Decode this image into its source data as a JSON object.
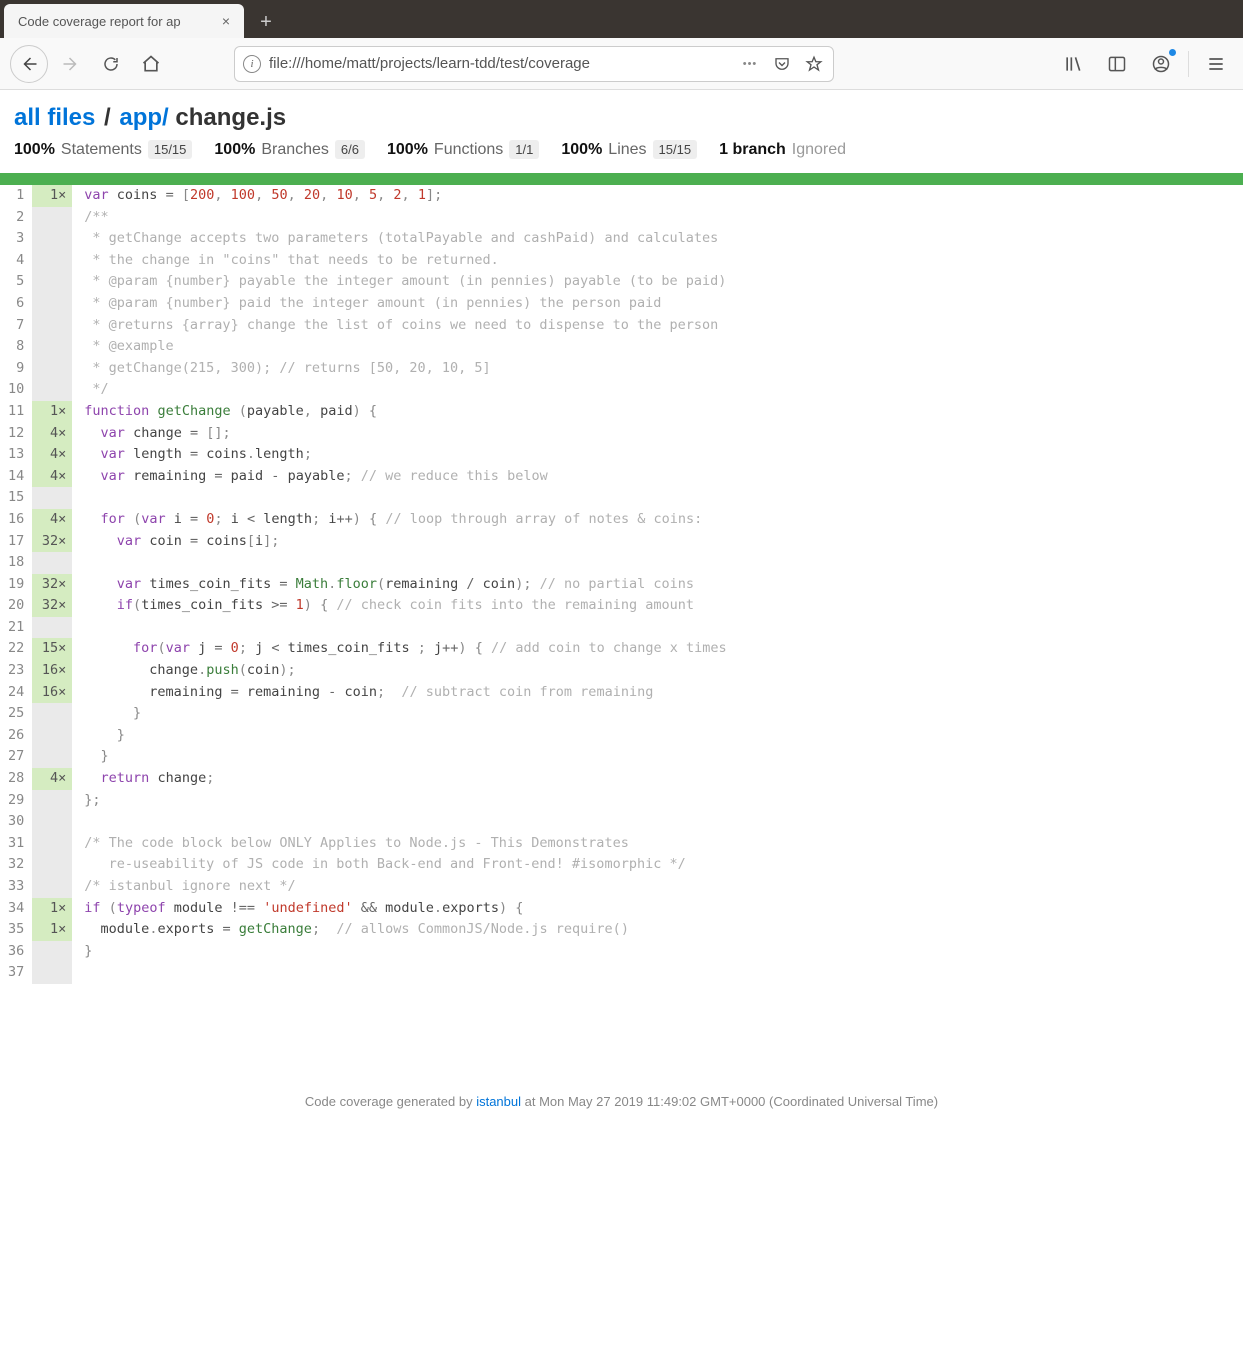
{
  "browser": {
    "tab_title": "Code coverage report for ap",
    "url": "file:///home/matt/projects/learn-tdd/test/coverage",
    "new_tab_glyph": "+",
    "close_glyph": "×",
    "info_glyph": "i",
    "dots_glyph": "•••"
  },
  "breadcrumb": {
    "root": "all files",
    "folder": "app/",
    "file": "change.js",
    "sep": "/"
  },
  "stats": [
    {
      "pct": "100%",
      "label": "Statements",
      "frac": "15/15"
    },
    {
      "pct": "100%",
      "label": "Branches",
      "frac": "6/6"
    },
    {
      "pct": "100%",
      "label": "Functions",
      "frac": "1/1"
    },
    {
      "pct": "100%",
      "label": "Lines",
      "frac": "15/15"
    }
  ],
  "ignored": {
    "bold": "1 branch",
    "label": "Ignored"
  },
  "code": {
    "lines": [
      {
        "n": 1,
        "hits": "1×",
        "tokens": [
          [
            "kw",
            "var"
          ],
          [
            "",
            " "
          ],
          [
            "id",
            "coins"
          ],
          [
            "",
            " "
          ],
          [
            "op",
            "="
          ],
          [
            "",
            " "
          ],
          [
            "pn",
            "["
          ],
          [
            "num",
            "200"
          ],
          [
            "pn",
            ","
          ],
          [
            "",
            " "
          ],
          [
            "num",
            "100"
          ],
          [
            "pn",
            ","
          ],
          [
            "",
            " "
          ],
          [
            "num",
            "50"
          ],
          [
            "pn",
            ","
          ],
          [
            "",
            " "
          ],
          [
            "num",
            "20"
          ],
          [
            "pn",
            ","
          ],
          [
            "",
            " "
          ],
          [
            "num",
            "10"
          ],
          [
            "pn",
            ","
          ],
          [
            "",
            " "
          ],
          [
            "num",
            "5"
          ],
          [
            "pn",
            ","
          ],
          [
            "",
            " "
          ],
          [
            "num",
            "2"
          ],
          [
            "pn",
            ","
          ],
          [
            "",
            " "
          ],
          [
            "num",
            "1"
          ],
          [
            "pn",
            "];"
          ]
        ]
      },
      {
        "n": 2,
        "hits": "",
        "tokens": [
          [
            "cm",
            "/**"
          ]
        ]
      },
      {
        "n": 3,
        "hits": "",
        "tokens": [
          [
            "cm",
            " * getChange accepts two parameters (totalPayable and cashPaid) and calculates"
          ]
        ]
      },
      {
        "n": 4,
        "hits": "",
        "tokens": [
          [
            "cm",
            " * the change in \"coins\" that needs to be returned."
          ]
        ]
      },
      {
        "n": 5,
        "hits": "",
        "tokens": [
          [
            "cm",
            " * @param {number} payable the integer amount (in pennies) payable (to be paid)"
          ]
        ]
      },
      {
        "n": 6,
        "hits": "",
        "tokens": [
          [
            "cm",
            " * @param {number} paid the integer amount (in pennies) the person paid"
          ]
        ]
      },
      {
        "n": 7,
        "hits": "",
        "tokens": [
          [
            "cm",
            " * @returns {array} change the list of coins we need to dispense to the person"
          ]
        ]
      },
      {
        "n": 8,
        "hits": "",
        "tokens": [
          [
            "cm",
            " * @example"
          ]
        ]
      },
      {
        "n": 9,
        "hits": "",
        "tokens": [
          [
            "cm",
            " * getChange(215, 300); // returns [50, 20, 10, 5]"
          ]
        ]
      },
      {
        "n": 10,
        "hits": "",
        "tokens": [
          [
            "cm",
            " */"
          ]
        ]
      },
      {
        "n": 11,
        "hits": "1×",
        "tokens": [
          [
            "kw",
            "function"
          ],
          [
            "",
            " "
          ],
          [
            "fn",
            "getChange"
          ],
          [
            "",
            " "
          ],
          [
            "pn",
            "("
          ],
          [
            "id",
            "payable"
          ],
          [
            "pn",
            ","
          ],
          [
            "",
            " "
          ],
          [
            "id",
            "paid"
          ],
          [
            "pn",
            ")"
          ],
          [
            "",
            " "
          ],
          [
            "pn",
            "{"
          ]
        ]
      },
      {
        "n": 12,
        "hits": "4×",
        "tokens": [
          [
            "",
            "  "
          ],
          [
            "kw",
            "var"
          ],
          [
            "",
            " "
          ],
          [
            "id",
            "change"
          ],
          [
            "",
            " "
          ],
          [
            "op",
            "="
          ],
          [
            "",
            " "
          ],
          [
            "pn",
            "[];"
          ]
        ]
      },
      {
        "n": 13,
        "hits": "4×",
        "tokens": [
          [
            "",
            "  "
          ],
          [
            "kw",
            "var"
          ],
          [
            "",
            " "
          ],
          [
            "id",
            "length"
          ],
          [
            "",
            " "
          ],
          [
            "op",
            "="
          ],
          [
            "",
            " "
          ],
          [
            "id",
            "coins"
          ],
          [
            "pn",
            "."
          ],
          [
            "id",
            "length"
          ],
          [
            "pn",
            ";"
          ]
        ]
      },
      {
        "n": 14,
        "hits": "4×",
        "tokens": [
          [
            "",
            "  "
          ],
          [
            "kw",
            "var"
          ],
          [
            "",
            " "
          ],
          [
            "id",
            "remaining"
          ],
          [
            "",
            " "
          ],
          [
            "op",
            "="
          ],
          [
            "",
            " "
          ],
          [
            "id",
            "paid"
          ],
          [
            "",
            " "
          ],
          [
            "op",
            "-"
          ],
          [
            "",
            " "
          ],
          [
            "id",
            "payable"
          ],
          [
            "pn",
            ";"
          ],
          [
            "",
            " "
          ],
          [
            "cm",
            "// we reduce this below"
          ]
        ]
      },
      {
        "n": 15,
        "hits": "",
        "tokens": [
          [
            "",
            " "
          ]
        ]
      },
      {
        "n": 16,
        "hits": "4×",
        "tokens": [
          [
            "",
            "  "
          ],
          [
            "kw",
            "for"
          ],
          [
            "",
            " "
          ],
          [
            "pn",
            "("
          ],
          [
            "kw",
            "var"
          ],
          [
            "",
            " "
          ],
          [
            "id",
            "i"
          ],
          [
            "",
            " "
          ],
          [
            "op",
            "="
          ],
          [
            "",
            " "
          ],
          [
            "num",
            "0"
          ],
          [
            "pn",
            ";"
          ],
          [
            "",
            " "
          ],
          [
            "id",
            "i"
          ],
          [
            "",
            " "
          ],
          [
            "op",
            "<"
          ],
          [
            "",
            " "
          ],
          [
            "id",
            "length"
          ],
          [
            "pn",
            ";"
          ],
          [
            "",
            " "
          ],
          [
            "id",
            "i"
          ],
          [
            "op",
            "++"
          ],
          [
            "pn",
            ")"
          ],
          [
            "",
            " "
          ],
          [
            "pn",
            "{"
          ],
          [
            "",
            " "
          ],
          [
            "cm",
            "// loop through array of notes & coins:"
          ]
        ]
      },
      {
        "n": 17,
        "hits": "32×",
        "tokens": [
          [
            "",
            "    "
          ],
          [
            "kw",
            "var"
          ],
          [
            "",
            " "
          ],
          [
            "id",
            "coin"
          ],
          [
            "",
            " "
          ],
          [
            "op",
            "="
          ],
          [
            "",
            " "
          ],
          [
            "id",
            "coins"
          ],
          [
            "pn",
            "["
          ],
          [
            "id",
            "i"
          ],
          [
            "pn",
            "];"
          ]
        ]
      },
      {
        "n": 18,
        "hits": "",
        "tokens": [
          [
            "",
            " "
          ]
        ]
      },
      {
        "n": 19,
        "hits": "32×",
        "tokens": [
          [
            "",
            "    "
          ],
          [
            "kw",
            "var"
          ],
          [
            "",
            " "
          ],
          [
            "id",
            "times_coin_fits"
          ],
          [
            "",
            " "
          ],
          [
            "op",
            "="
          ],
          [
            "",
            " "
          ],
          [
            "fn",
            "Math"
          ],
          [
            "pn",
            "."
          ],
          [
            "fn",
            "floor"
          ],
          [
            "pn",
            "("
          ],
          [
            "id",
            "remaining"
          ],
          [
            "",
            " "
          ],
          [
            "op",
            "/"
          ],
          [
            "",
            " "
          ],
          [
            "id",
            "coin"
          ],
          [
            "pn",
            ");"
          ],
          [
            "",
            " "
          ],
          [
            "cm",
            "// no partial coins"
          ]
        ]
      },
      {
        "n": 20,
        "hits": "32×",
        "tokens": [
          [
            "",
            "    "
          ],
          [
            "kw",
            "if"
          ],
          [
            "pn",
            "("
          ],
          [
            "id",
            "times_coin_fits"
          ],
          [
            "",
            " "
          ],
          [
            "op",
            ">="
          ],
          [
            "",
            " "
          ],
          [
            "num",
            "1"
          ],
          [
            "pn",
            ")"
          ],
          [
            "",
            " "
          ],
          [
            "pn",
            "{"
          ],
          [
            "",
            " "
          ],
          [
            "cm",
            "// check coin fits into the remaining amount"
          ]
        ]
      },
      {
        "n": 21,
        "hits": "",
        "tokens": [
          [
            "",
            " "
          ]
        ]
      },
      {
        "n": 22,
        "hits": "15×",
        "tokens": [
          [
            "",
            "      "
          ],
          [
            "kw",
            "for"
          ],
          [
            "pn",
            "("
          ],
          [
            "kw",
            "var"
          ],
          [
            "",
            " "
          ],
          [
            "id",
            "j"
          ],
          [
            "",
            " "
          ],
          [
            "op",
            "="
          ],
          [
            "",
            " "
          ],
          [
            "num",
            "0"
          ],
          [
            "pn",
            ";"
          ],
          [
            "",
            " "
          ],
          [
            "id",
            "j"
          ],
          [
            "",
            " "
          ],
          [
            "op",
            "<"
          ],
          [
            "",
            " "
          ],
          [
            "id",
            "times_coin_fits"
          ],
          [
            "",
            " "
          ],
          [
            "pn",
            ";"
          ],
          [
            "",
            " "
          ],
          [
            "id",
            "j"
          ],
          [
            "op",
            "++"
          ],
          [
            "pn",
            ")"
          ],
          [
            "",
            " "
          ],
          [
            "pn",
            "{"
          ],
          [
            "",
            " "
          ],
          [
            "cm",
            "// add coin to change x times"
          ]
        ]
      },
      {
        "n": 23,
        "hits": "16×",
        "tokens": [
          [
            "",
            "        "
          ],
          [
            "id",
            "change"
          ],
          [
            "pn",
            "."
          ],
          [
            "fn",
            "push"
          ],
          [
            "pn",
            "("
          ],
          [
            "id",
            "coin"
          ],
          [
            "pn",
            ");"
          ]
        ]
      },
      {
        "n": 24,
        "hits": "16×",
        "tokens": [
          [
            "",
            "        "
          ],
          [
            "id",
            "remaining"
          ],
          [
            "",
            " "
          ],
          [
            "op",
            "="
          ],
          [
            "",
            " "
          ],
          [
            "id",
            "remaining"
          ],
          [
            "",
            " "
          ],
          [
            "op",
            "-"
          ],
          [
            "",
            " "
          ],
          [
            "id",
            "coin"
          ],
          [
            "pn",
            ";"
          ],
          [
            "",
            "  "
          ],
          [
            "cm",
            "// subtract coin from remaining"
          ]
        ]
      },
      {
        "n": 25,
        "hits": "",
        "tokens": [
          [
            "",
            "      "
          ],
          [
            "pn",
            "}"
          ]
        ]
      },
      {
        "n": 26,
        "hits": "",
        "tokens": [
          [
            "",
            "    "
          ],
          [
            "pn",
            "}"
          ]
        ]
      },
      {
        "n": 27,
        "hits": "",
        "tokens": [
          [
            "",
            "  "
          ],
          [
            "pn",
            "}"
          ]
        ]
      },
      {
        "n": 28,
        "hits": "4×",
        "tokens": [
          [
            "",
            "  "
          ],
          [
            "kw",
            "return"
          ],
          [
            "",
            " "
          ],
          [
            "id",
            "change"
          ],
          [
            "pn",
            ";"
          ]
        ]
      },
      {
        "n": 29,
        "hits": "",
        "tokens": [
          [
            "pn",
            "};"
          ]
        ]
      },
      {
        "n": 30,
        "hits": "",
        "tokens": [
          [
            "",
            " "
          ]
        ]
      },
      {
        "n": 31,
        "hits": "",
        "tokens": [
          [
            "cm",
            "/* The code block below ONLY Applies to Node.js - This Demonstrates"
          ]
        ]
      },
      {
        "n": 32,
        "hits": "",
        "tokens": [
          [
            "cm",
            "   re-useability of JS code in both Back-end and Front-end! #isomorphic */"
          ]
        ]
      },
      {
        "n": 33,
        "hits": "",
        "tokens": [
          [
            "cm",
            "/* istanbul ignore next */"
          ]
        ]
      },
      {
        "n": 34,
        "hits": "1×",
        "tokens": [
          [
            "kw",
            "if"
          ],
          [
            "",
            " "
          ],
          [
            "pn",
            "("
          ],
          [
            "kw",
            "typeof"
          ],
          [
            "",
            " "
          ],
          [
            "id",
            "module"
          ],
          [
            "",
            " "
          ],
          [
            "op",
            "!=="
          ],
          [
            "",
            " "
          ],
          [
            "str",
            "'undefined'"
          ],
          [
            "",
            " "
          ],
          [
            "op",
            "&&"
          ],
          [
            "",
            " "
          ],
          [
            "id",
            "module"
          ],
          [
            "pn",
            "."
          ],
          [
            "id",
            "exports"
          ],
          [
            "pn",
            ")"
          ],
          [
            "",
            " "
          ],
          [
            "pn",
            "{"
          ]
        ]
      },
      {
        "n": 35,
        "hits": "1×",
        "tokens": [
          [
            "",
            "  "
          ],
          [
            "id",
            "module"
          ],
          [
            "pn",
            "."
          ],
          [
            "id",
            "exports"
          ],
          [
            "",
            " "
          ],
          [
            "op",
            "="
          ],
          [
            "",
            " "
          ],
          [
            "fn",
            "getChange"
          ],
          [
            "pn",
            ";"
          ],
          [
            "",
            "  "
          ],
          [
            "cm",
            "// allows CommonJS/Node.js require()"
          ]
        ]
      },
      {
        "n": 36,
        "hits": "",
        "tokens": [
          [
            "pn",
            "}"
          ]
        ]
      },
      {
        "n": 37,
        "hits": "",
        "tokens": [
          [
            "",
            " "
          ]
        ]
      }
    ]
  },
  "footer": {
    "prefix": "Code coverage generated by ",
    "tool": "istanbul",
    "at": " at Mon May 27 2019 11:49:02 GMT+0000 (Coordinated Universal Time)"
  }
}
